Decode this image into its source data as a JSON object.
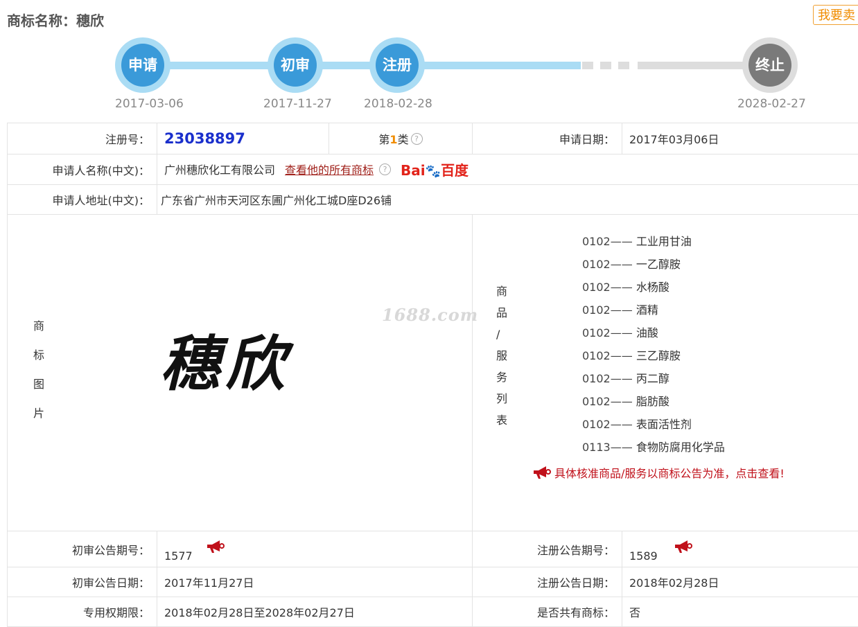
{
  "header": {
    "title": "商标名称：穗欣",
    "sell_button": "我要卖"
  },
  "timeline": {
    "steps": [
      {
        "label": "申请",
        "date": "2017-03-06"
      },
      {
        "label": "初审",
        "date": "2017-11-27"
      },
      {
        "label": "注册",
        "date": "2018-02-28"
      },
      {
        "label": "终止",
        "date": "2028-02-27"
      }
    ],
    "active_color": "#3a9ad9",
    "inactive_color": "#7a7a7a"
  },
  "info": {
    "reg_no_label": "注册号：",
    "reg_no": "23038897",
    "class_prefix": "第",
    "class_num": "1",
    "class_suffix": "类",
    "apply_date_label": "申请日期：",
    "apply_date": "2017年03月06日",
    "applicant_label": "申请人名称(中文)：",
    "applicant": "广州穗欣化工有限公司",
    "applicant_link": "查看他的所有商标",
    "baidu_text_1": "Bai",
    "baidu_paw": "🐾",
    "baidu_text_2": "百度",
    "address_label": "申请人地址(中文)：",
    "address": "广东省广州市天河区东圃广州化工城D座D26铺",
    "mark_image_label": [
      "商",
      "标",
      "图",
      "片"
    ],
    "mark_text": "穗欣",
    "watermark": "1688.com",
    "goods_label": [
      "商",
      "品",
      "/",
      "服",
      "务",
      "列",
      "表"
    ],
    "goods": [
      {
        "code": "0102——",
        "name": "工业用甘油"
      },
      {
        "code": "0102——",
        "name": "一乙醇胺"
      },
      {
        "code": "0102——",
        "name": "水杨酸"
      },
      {
        "code": "0102——",
        "name": "酒精"
      },
      {
        "code": "0102——",
        "name": "油酸"
      },
      {
        "code": "0102——",
        "name": "三乙醇胺"
      },
      {
        "code": "0102——",
        "name": "丙二醇"
      },
      {
        "code": "0102——",
        "name": "脂肪酸"
      },
      {
        "code": "0102——",
        "name": "表面活性剂"
      },
      {
        "code": "0113——",
        "name": "食物防腐用化学品"
      }
    ],
    "goods_notice": "具体核准商品/服务以商标公告为准，点击查看!",
    "prelim_no_label": "初审公告期号：",
    "prelim_no": "1577",
    "reg_notice_no_label": "注册公告期号：",
    "reg_notice_no": "1589",
    "prelim_date_label": "初审公告日期：",
    "prelim_date": "2017年11月27日",
    "reg_notice_date_label": "注册公告日期：",
    "reg_notice_date": "2018年02月28日",
    "exclusive_label": "专用权期限：",
    "exclusive_period": "2018年02月28日至2028年02月27日",
    "shared_label": "是否共有商标：",
    "shared": "否"
  }
}
